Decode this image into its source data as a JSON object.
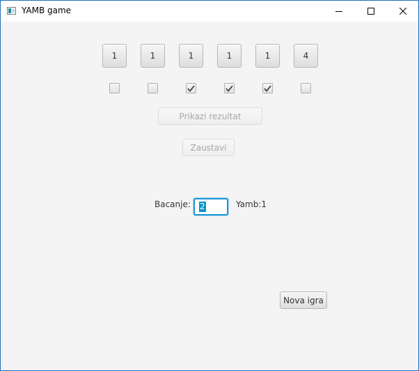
{
  "window": {
    "title": "YAMB game",
    "controls": {
      "minimize_icon": "minimize-icon",
      "maximize_icon": "maximize-icon",
      "close_icon": "close-icon"
    }
  },
  "dice": [
    {
      "value": "1",
      "held": false
    },
    {
      "value": "1",
      "held": false
    },
    {
      "value": "1",
      "held": true
    },
    {
      "value": "1",
      "held": true
    },
    {
      "value": "1",
      "held": true
    },
    {
      "value": "4",
      "held": false
    }
  ],
  "actions": {
    "show_result_label": "Prikazi rezultat",
    "show_result_enabled": false,
    "stop_label": "Zaustavi",
    "stop_enabled": false,
    "new_game_label": "Nova igra"
  },
  "throw": {
    "label": "Bacanje:",
    "value": "2"
  },
  "yamb": {
    "label": "Yamb:1"
  },
  "colors": {
    "focus_border": "#1e96d6",
    "selection": "#0096c9",
    "window_border": "#1d6fbe"
  }
}
